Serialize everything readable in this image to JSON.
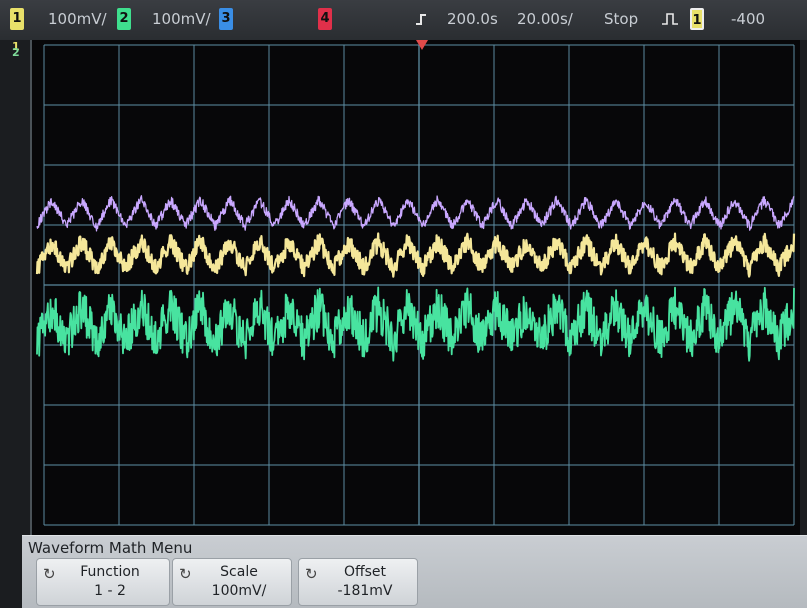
{
  "status": {
    "ch1": {
      "num": "1",
      "scale": "100mV/",
      "color": "#e8e06a"
    },
    "ch2": {
      "num": "2",
      "scale": "100mV/",
      "color": "#3fdf8e"
    },
    "ch3": {
      "num": "3",
      "color": "#3a8ee6"
    },
    "ch4": {
      "num": "4",
      "color": "#e0304a"
    },
    "trigger_pos": "200.0s",
    "timebase": "20.00s/",
    "run_state": "Stop",
    "trigger_source": "1",
    "trigger_level": "-400"
  },
  "markers": {
    "ch1_ground": "1",
    "ch2_ground": "2"
  },
  "menu": {
    "title": "Waveform Math Menu",
    "function": {
      "label": "Function",
      "value": "1 - 2"
    },
    "scale": {
      "label": "Scale",
      "value": "100mV/"
    },
    "offset": {
      "label": "Offset",
      "value": "-181mV"
    }
  },
  "trace_colors": {
    "math": "#c9a8ff",
    "ch1": "#f5e79a",
    "ch2": "#48e3a0",
    "grid": "#5f90a6"
  },
  "waveforms": {
    "cycles": 25.5,
    "math": {
      "center_div": 2.8,
      "amplitude_div": 0.22
    },
    "ch1": {
      "center_div": 3.5,
      "amplitude_div": 0.22
    },
    "ch2": {
      "center_div": 4.65,
      "amplitude_div": 0.28
    }
  }
}
